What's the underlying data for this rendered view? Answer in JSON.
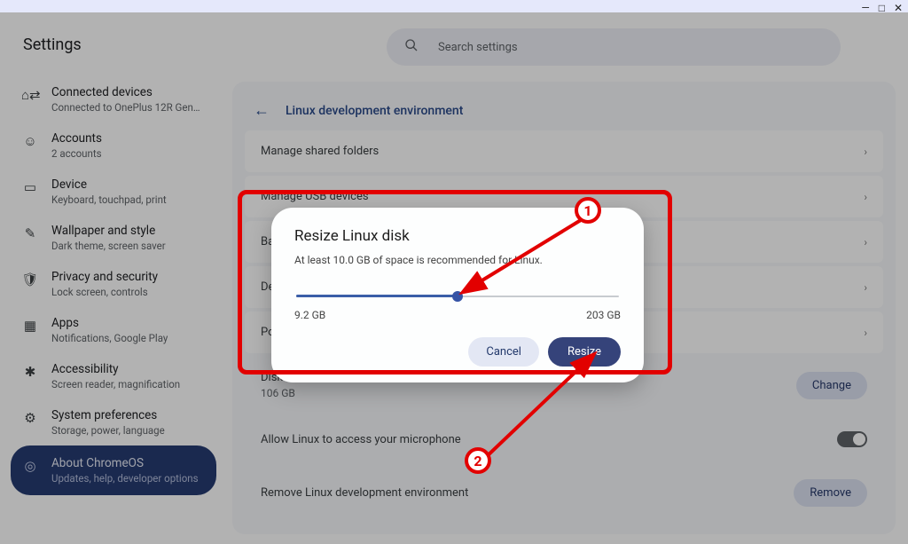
{
  "window": {
    "minimize": "—",
    "maximize": "□",
    "close": "✕"
  },
  "header": {
    "title": "Settings"
  },
  "search": {
    "placeholder": "Search settings"
  },
  "sidebar": {
    "items": [
      {
        "icon": "⌂⇄",
        "title": "Connected devices",
        "sub": "Connected to OnePlus 12R Gens…"
      },
      {
        "icon": "☺",
        "title": "Accounts",
        "sub": "2 accounts"
      },
      {
        "icon": "▭",
        "title": "Device",
        "sub": "Keyboard, touchpad, print"
      },
      {
        "icon": "✎",
        "title": "Wallpaper and style",
        "sub": "Dark theme, screen saver"
      },
      {
        "icon": "🛡",
        "title": "Privacy and security",
        "sub": "Lock screen, controls"
      },
      {
        "icon": "▦",
        "title": "Apps",
        "sub": "Notifications, Google Play"
      },
      {
        "icon": "✱",
        "title": "Accessibility",
        "sub": "Screen reader, magnification"
      },
      {
        "icon": "⚙",
        "title": "System preferences",
        "sub": "Storage, power, language"
      },
      {
        "icon": "◎",
        "title": "About ChromeOS",
        "sub": "Updates, help, developer options"
      }
    ]
  },
  "main": {
    "back": "←",
    "title": "Linux development environment",
    "rows": [
      {
        "label": "Manage shared folders"
      },
      {
        "label": "Manage USB devices"
      },
      {
        "label": "Backup & restore"
      },
      {
        "label": "Develop Android apps"
      },
      {
        "label": "Port forwarding"
      }
    ],
    "disk": {
      "label": "Disk size",
      "value": "106 GB",
      "button": "Change"
    },
    "mic": {
      "label": "Allow Linux to access your microphone"
    },
    "remove": {
      "label": "Remove Linux development environment",
      "button": "Remove"
    },
    "chevron": "›"
  },
  "dialog": {
    "title": "Resize Linux disk",
    "hint": "At least 10.0 GB of space is recommended for Linux.",
    "min": "9.2 GB",
    "max": "203 GB",
    "cancel": "Cancel",
    "confirm": "Resize"
  },
  "annot": {
    "b1": "1",
    "b2": "2"
  }
}
